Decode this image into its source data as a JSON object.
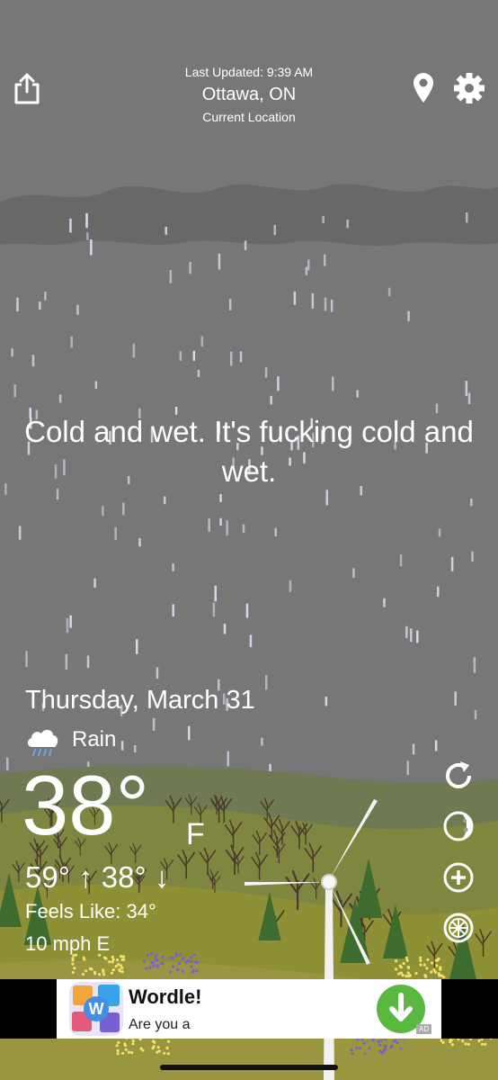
{
  "header": {
    "last_updated": "Last Updated: 9:39 AM",
    "location": "Ottawa, ON",
    "location_sub": "Current Location",
    "icons": [
      "share-icon",
      "location-pin-icon",
      "settings-gear-icon"
    ]
  },
  "forecast_message": "Cold and wet. It's fucking cold and wet.",
  "weather": {
    "date": "Thursday, March 31",
    "condition": "Rain",
    "condition_icon": "rain-cloud-icon",
    "temperature": "38°",
    "unit": "F",
    "high": "59°",
    "low": "38°",
    "feels_like": "Feels Like: 34°",
    "wind": "10 mph E"
  },
  "side_buttons": [
    "refresh-icon",
    "moon-icon",
    "add-icon",
    "wheel-icon"
  ],
  "ad": {
    "title": "Wordle!",
    "subtitle": "Are you a",
    "badge": "AD",
    "colors": {
      "download": "#5ab841"
    }
  },
  "colors": {
    "sky": "#777777",
    "hill_green": "#8a8e3a",
    "tree": "#3e6b2e"
  }
}
